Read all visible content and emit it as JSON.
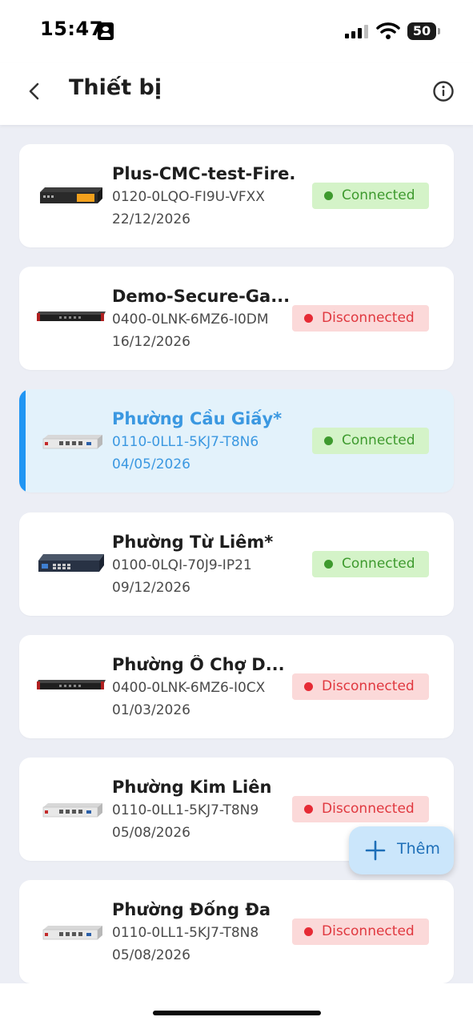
{
  "status_bar": {
    "time": "15:47",
    "battery_level": "50",
    "icons": [
      "id-card-icon",
      "signal-icon",
      "wifi-icon",
      "battery-icon"
    ]
  },
  "header": {
    "title": "Thiết bị",
    "back_icon": "chevron-left-icon",
    "info_icon": "info-circle-icon"
  },
  "devices": [
    {
      "name": "Plus-CMC-test-Fire...",
      "serial": "0120-0LQO-FI9U-VFXX",
      "date": "22/12/2026",
      "status": "Connected",
      "status_type": "connected",
      "selected": false,
      "thumb": "firewall-orange"
    },
    {
      "name": "Demo-Secure-Ga...",
      "serial": "0400-0LNK-6MZ6-I0DM",
      "date": "16/12/2026",
      "status": "Disconnected",
      "status_type": "disconnected",
      "selected": false,
      "thumb": "rack-black"
    },
    {
      "name": "Phường Cầu Giấy*",
      "serial": "0110-0LL1-5KJ7-T8N6",
      "date": "04/05/2026",
      "status": "Connected",
      "status_type": "connected",
      "selected": true,
      "thumb": "desktop-silver"
    },
    {
      "name": "Phường Từ Liêm*",
      "serial": "0100-0LQI-70J9-IP21",
      "date": "09/12/2026",
      "status": "Connected",
      "status_type": "connected",
      "selected": false,
      "thumb": "switch-navy"
    },
    {
      "name": "Phường Ô Chợ D...",
      "serial": "0400-0LNK-6MZ6-I0CX",
      "date": "01/03/2026",
      "status": "Disconnected",
      "status_type": "disconnected",
      "selected": false,
      "thumb": "rack-black"
    },
    {
      "name": "Phường Kim Liên",
      "serial": "0110-0LL1-5KJ7-T8N9",
      "date": "05/08/2026",
      "status": "Disconnected",
      "status_type": "disconnected",
      "selected": false,
      "thumb": "desktop-silver"
    },
    {
      "name": "Phường Đống Đa",
      "serial": "0110-0LL1-5KJ7-T8N8",
      "date": "05/08/2026",
      "status": "Disconnected",
      "status_type": "disconnected",
      "selected": false,
      "thumb": "desktop-silver"
    }
  ],
  "add_button": {
    "label": "Thêm",
    "icon": "plus-icon"
  },
  "colors": {
    "accent": "#2196f3",
    "connected_text": "#3e9a2e",
    "connected_bg": "#d4f3c8",
    "disconnected_text": "#e0383f",
    "disconnected_bg": "#fbd9d9",
    "selected_bg": "#e3f2fb"
  }
}
